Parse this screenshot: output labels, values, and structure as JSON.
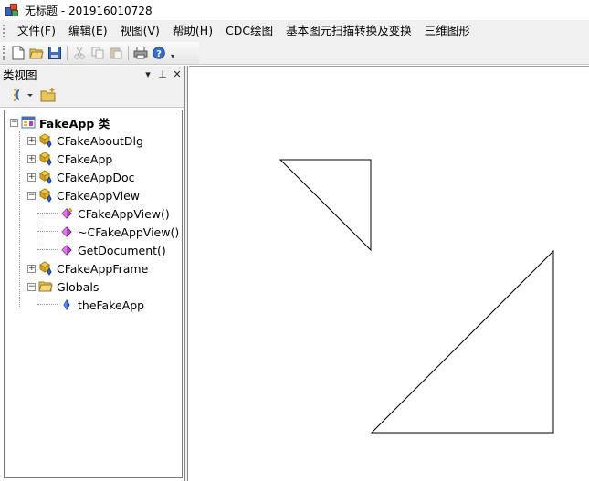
{
  "window": {
    "title": "无标题 - 201916010728"
  },
  "menubar": {
    "items": [
      {
        "label": "文件(F)"
      },
      {
        "label": "编辑(E)"
      },
      {
        "label": "视图(V)"
      },
      {
        "label": "帮助(H)"
      },
      {
        "label": "CDC绘图"
      },
      {
        "label": "基本图元扫描转换及变换"
      },
      {
        "label": "三维图形"
      }
    ]
  },
  "toolbar": {
    "buttons": [
      {
        "icon": "new-document-icon"
      },
      {
        "icon": "open-folder-icon"
      },
      {
        "icon": "save-icon"
      },
      {
        "icon": "cut-icon"
      },
      {
        "icon": "copy-icon"
      },
      {
        "icon": "paste-icon"
      },
      {
        "icon": "print-icon"
      },
      {
        "icon": "help-icon"
      }
    ]
  },
  "classview": {
    "title": "类视图",
    "header_buttons": [
      "▾",
      "⊥",
      "✕"
    ],
    "tree": {
      "root": {
        "label": "FakeApp 类",
        "expander": "−"
      },
      "nodes": [
        {
          "label": "CFakeAboutDlg",
          "expander": "+"
        },
        {
          "label": "CFakeApp",
          "expander": "+"
        },
        {
          "label": "CFakeAppDoc",
          "expander": "+"
        },
        {
          "label": "CFakeAppView",
          "expander": "−"
        },
        {
          "label": "CFakeAppView()"
        },
        {
          "label": "~CFakeAppView()"
        },
        {
          "label": "GetDocument()"
        },
        {
          "label": "CFakeAppFrame",
          "expander": "+"
        },
        {
          "label": "Globals",
          "expander": "−"
        },
        {
          "label": "theFakeApp"
        }
      ]
    }
  },
  "colors": {
    "menu_bg": "#f0f0f0",
    "class_icon": "#e8b82a",
    "method_icon": "#b23ac7",
    "global_icon": "#2a64d6",
    "triangle_stroke": "#000000"
  }
}
